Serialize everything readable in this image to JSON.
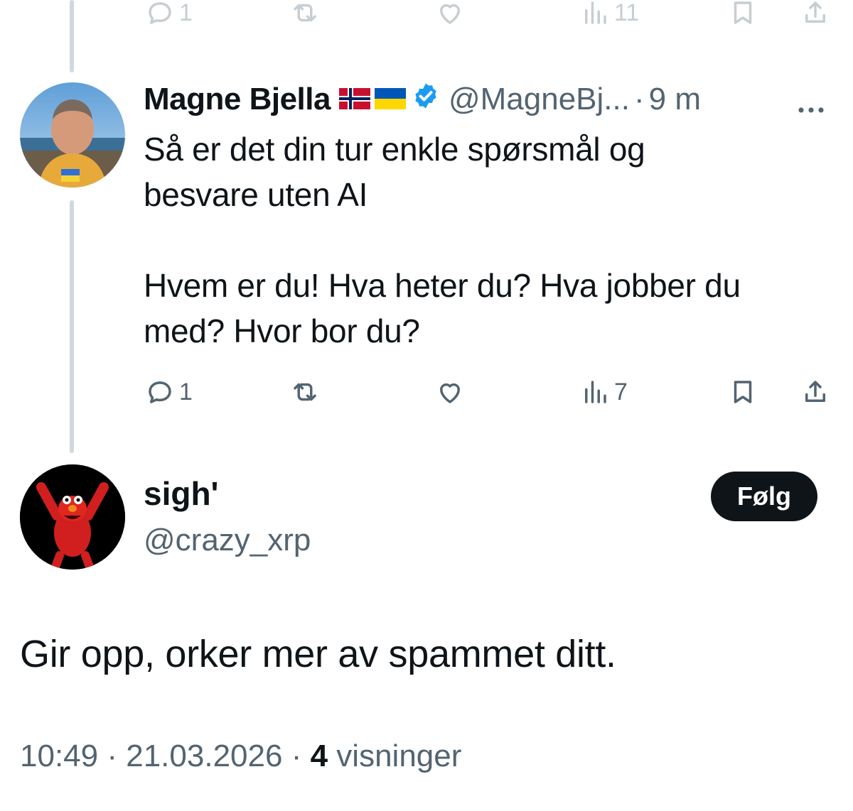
{
  "top_tweet_actions": {
    "reply_count": "1",
    "views_count": "11"
  },
  "tweet": {
    "display_name": "Magne Bjella",
    "flags": [
      "norway-flag",
      "ukraine-flag"
    ],
    "verified": true,
    "handle": "@MagneBj...",
    "separator": "·",
    "time": "9 m",
    "body_paragraph_1": "Så er det din tur enkle spørsmål og besvare uten AI",
    "body_paragraph_2": "Hvem er du! Hva heter du? Hva jobber du med? Hvor bor du?",
    "actions": {
      "reply_count": "1",
      "views_count": "7"
    }
  },
  "reply": {
    "display_name": "sigh'",
    "handle": "@crazy_xrp",
    "follow_label": "Følg",
    "text": "Gir opp, orker mer av spammet ditt.",
    "time": "10:49",
    "separator": "·",
    "date": "21.03.2026",
    "views_count": "4",
    "views_label": "visninger"
  },
  "icons": [
    "reply-icon",
    "retweet-icon",
    "like-icon",
    "views-icon",
    "bookmark-icon",
    "share-icon",
    "more-icon",
    "verified-icon"
  ],
  "colors": {
    "text_primary": "#0f1419",
    "text_secondary": "#536471",
    "thread_line": "#cfd9de",
    "verified_blue": "#1d9bf0",
    "follow_button_bg": "#0f1419"
  }
}
